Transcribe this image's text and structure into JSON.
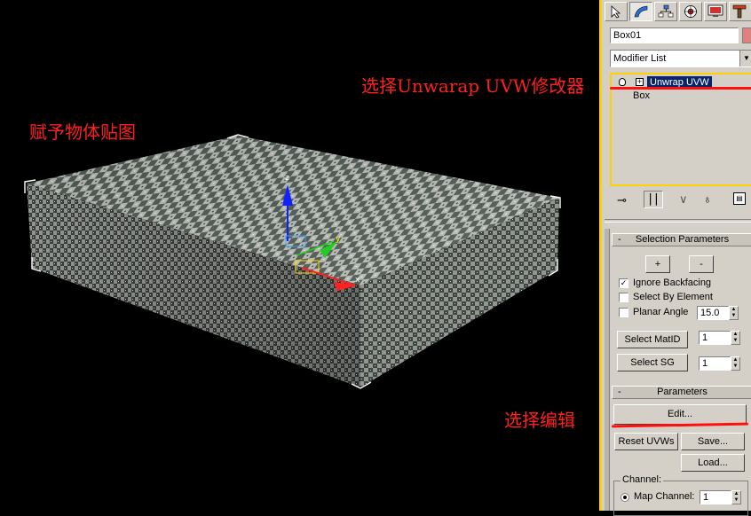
{
  "annotations": {
    "assign_map": "赋予物体贴图",
    "select_unwrap": "选择Unwarap UVW修改器",
    "select_edit": "选择编辑"
  },
  "colors": {
    "annotation": "#ff2020",
    "panel_bg": "#d4d0c8",
    "highlight_bar": "#ffd100",
    "selected_modifier": "#0a246a"
  },
  "toolbar": {
    "icons": [
      "create-icon",
      "modify-icon",
      "hierarchy-icon",
      "motion-icon",
      "display-icon",
      "utilities-icon"
    ]
  },
  "object_name": "Box01",
  "modifier_list_label": "Modifier List",
  "modifier_stack": [
    "Unwrap UVW",
    "Box"
  ],
  "stack_icons": [
    "pin-stack-icon",
    "show-end-result-icon",
    "make-unique-icon",
    "remove-modifier-icon",
    "configure-sets-icon"
  ],
  "selection_parameters": {
    "title": "Selection Parameters",
    "rollout_toggle": "-",
    "plus_label": "+",
    "minus_label": "-",
    "ignore_backfacing": {
      "label": "Ignore Backfacing",
      "checked": true
    },
    "select_by_element": {
      "label": "Select By Element",
      "checked": false
    },
    "planar_angle": {
      "label": "Planar Angle",
      "checked": false,
      "value": "15.0"
    },
    "select_matid": {
      "label": "Select MatID",
      "value": "1"
    },
    "select_sg": {
      "label": "Select SG",
      "value": "1"
    }
  },
  "parameters": {
    "title": "Parameters",
    "rollout_toggle": "-",
    "edit_label": "Edit...",
    "reset_uvws_label": "Reset UVWs",
    "save_label": "Save...",
    "load_label": "Load...",
    "channel_label": "Channel:",
    "map_channel_label": "Map Channel:",
    "map_channel_value": "1"
  }
}
